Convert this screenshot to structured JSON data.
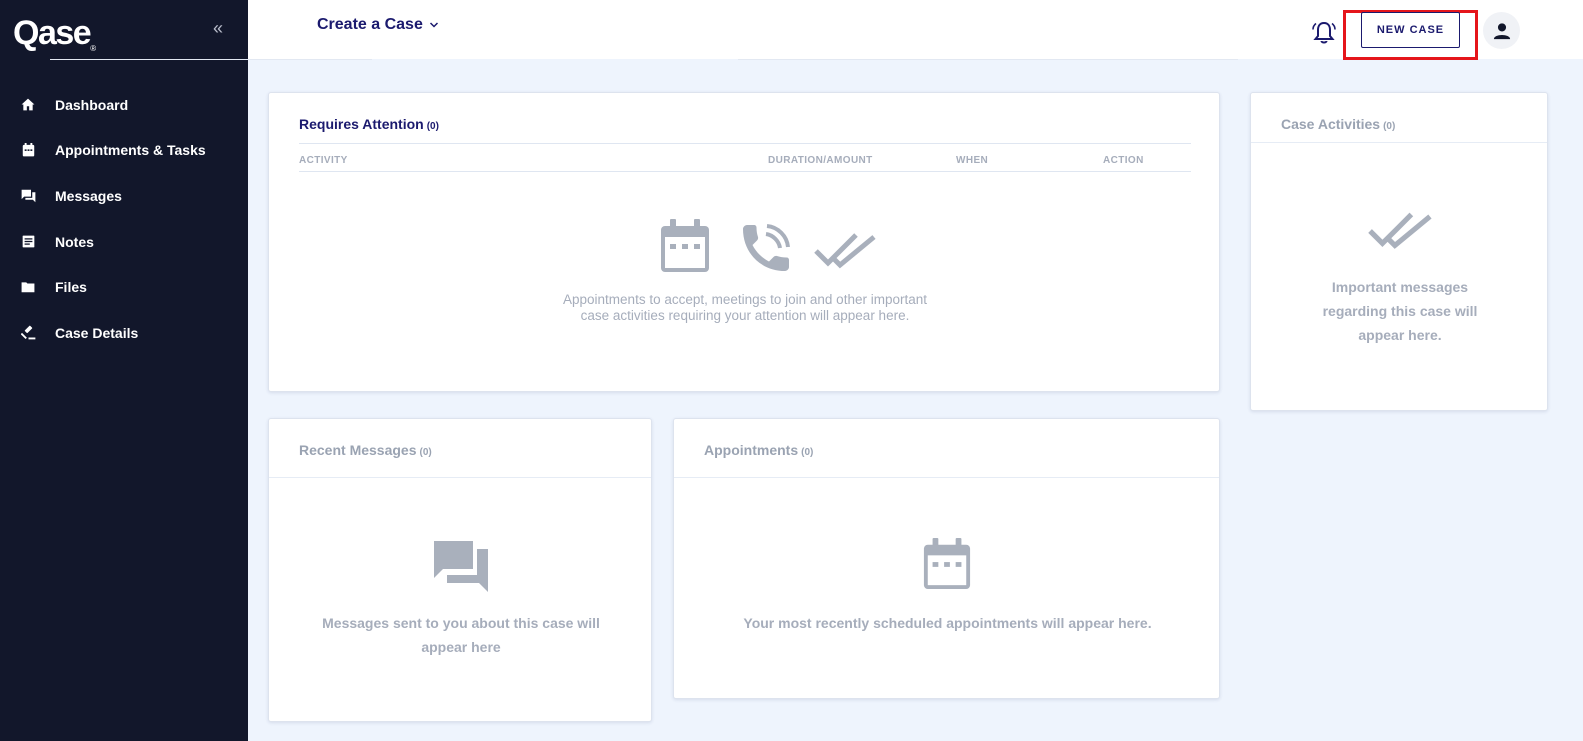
{
  "sidebar": {
    "logo": "Qase",
    "logo_mark": "®",
    "collapse_glyph": "«",
    "items": [
      {
        "label": "Dashboard",
        "icon": "home-icon"
      },
      {
        "label": "Appointments & Tasks",
        "icon": "calendar-icon"
      },
      {
        "label": "Messages",
        "icon": "chat-icon"
      },
      {
        "label": "Notes",
        "icon": "notes-icon"
      },
      {
        "label": "Files",
        "icon": "folder-icon"
      },
      {
        "label": "Case Details",
        "icon": "gavel-icon"
      }
    ]
  },
  "header": {
    "case_select_label": "Create a Case",
    "new_case_label": "NEW CASE",
    "highlight_color": "#e5151b"
  },
  "requires_attention": {
    "title": "Requires Attention",
    "count": "(0)",
    "columns": [
      "ACTIVITY",
      "DURATION/AMOUNT",
      "WHEN",
      "ACTION"
    ],
    "empty_line1": "Appointments to accept, meetings to join and other important",
    "empty_line2": "case activities requiring your attention will appear here."
  },
  "case_activities": {
    "title": "Case Activities",
    "count": "(0)",
    "empty_line1": "Important messages",
    "empty_line2": "regarding this case will",
    "empty_line3": "appear here."
  },
  "recent_messages": {
    "title": "Recent Messages",
    "count": "(0)",
    "empty_line1": "Messages sent to you about this case will",
    "empty_line2": "appear here"
  },
  "appointments": {
    "title": "Appointments",
    "count": "(0)",
    "empty_line1": "Your most recently scheduled appointments will appear here."
  }
}
